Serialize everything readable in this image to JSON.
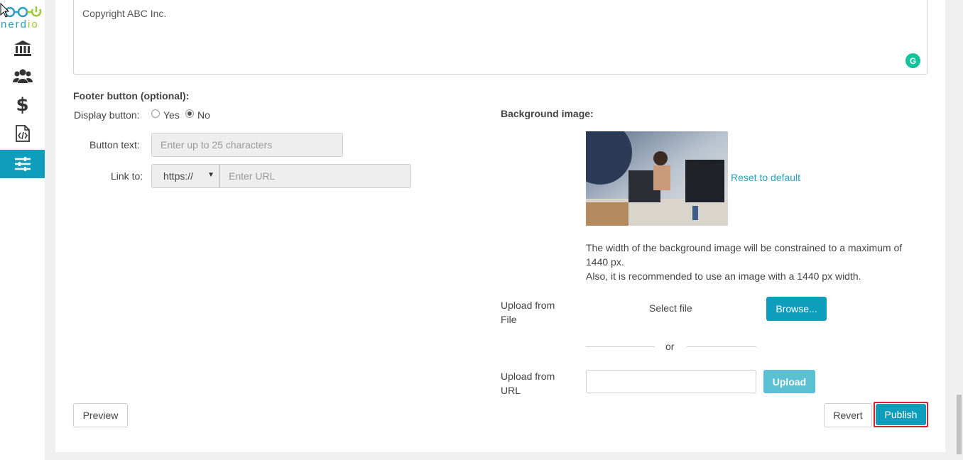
{
  "sidebar": {
    "logo": {
      "text_main": "nerd",
      "text_accent": "io"
    },
    "items": [
      {
        "icon": "bank-icon"
      },
      {
        "icon": "users-icon"
      },
      {
        "icon": "dollar-icon"
      },
      {
        "icon": "code-file-icon"
      },
      {
        "icon": "sliders-icon"
      }
    ]
  },
  "editor": {
    "content": "Copyright ABC Inc."
  },
  "footer_button": {
    "heading": "Footer button (optional):",
    "display_label": "Display button:",
    "yes_label": "Yes",
    "no_label": "No",
    "selected": "No",
    "button_text_label": "Button text:",
    "button_text_placeholder": "Enter up to 25 characters",
    "link_label": "Link to:",
    "protocol_value": "https://",
    "url_placeholder": "Enter URL"
  },
  "background_image": {
    "heading": "Background image:",
    "reset_link": "Reset to default",
    "note_line1": "The width of the background image will be constrained to a maximum of 1440 px.",
    "note_line2": "Also, it is recommended to use an image with a 1440 px width.",
    "upload_file_label": "Upload from File",
    "select_file_text": "Select file",
    "browse_label": "Browse...",
    "or_text": "or",
    "upload_url_label": "Upload from URL",
    "upload_button": "Upload"
  },
  "actions": {
    "preview": "Preview",
    "revert": "Revert",
    "publish": "Publish"
  },
  "colors": {
    "accent": "#0e9dbb",
    "highlight_border": "#d9202c",
    "grammarly": "#15c39a"
  }
}
